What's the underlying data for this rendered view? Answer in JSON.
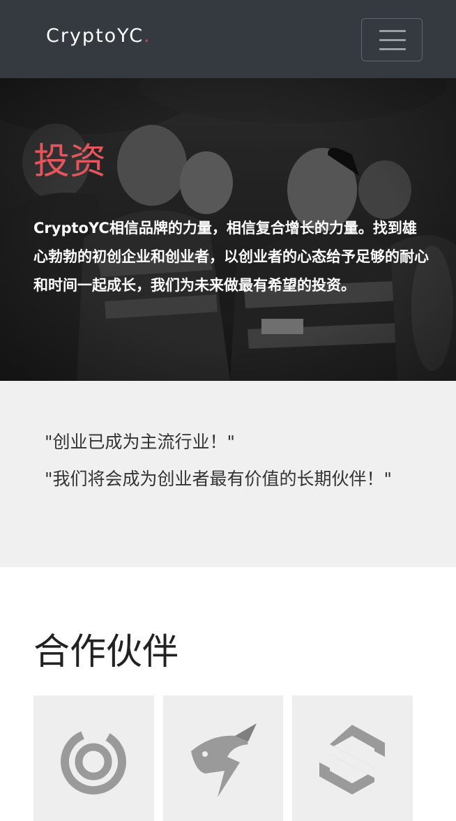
{
  "navbar": {
    "brand": "CryptoYC",
    "brand_dot": ".",
    "menu_icon": "hamburger-icon"
  },
  "hero": {
    "title": "投资",
    "description": "CryptoYC相信品牌的力量，相信复合增长的力量。找到雄心勃勃的初创企业和创业者，以创业者的心态给予足够的耐心和时间一起成长，我们为未来做最有希望的投资。"
  },
  "quotes": [
    "\"创业已成为主流行业！\"",
    "\"我们将会成为创业者最有价值的长期伙伴！\""
  ],
  "partners": {
    "title": "合作伙伴",
    "logos": [
      "ring-logo",
      "rabbit-bolt-logo",
      "hexagon-s-logo"
    ]
  },
  "colors": {
    "navbar_bg": "#343a40",
    "accent": "#e5555c",
    "quotes_bg": "#f0f0f0",
    "card_bg": "#eeeeee",
    "logo_gray": "#9a9a9a"
  }
}
